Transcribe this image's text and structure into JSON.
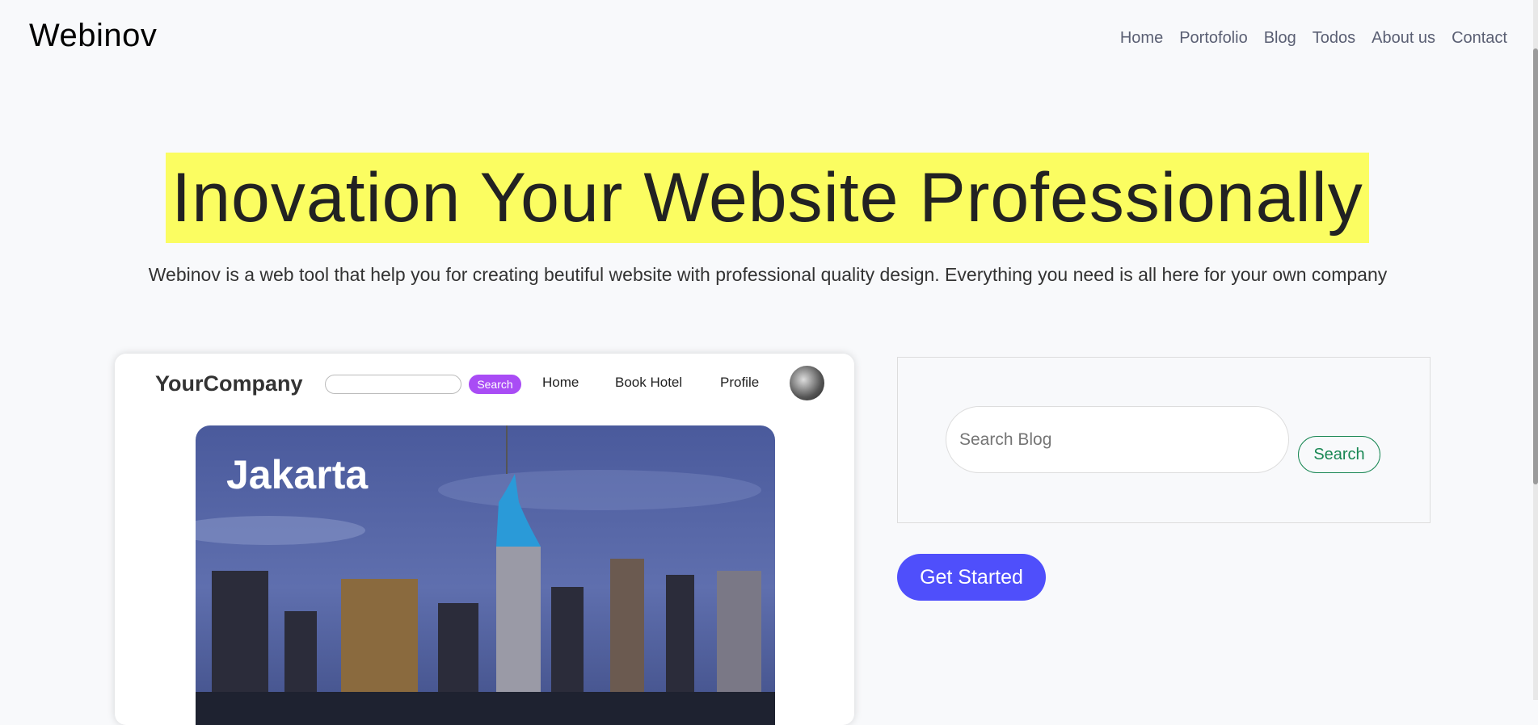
{
  "header": {
    "logo": "Webinov",
    "nav": [
      "Home",
      "Portofolio",
      "Blog",
      "Todos",
      "About us",
      "Contact"
    ]
  },
  "hero": {
    "title": "Inovation Your Website Professionally",
    "lead": "Webinov is a web tool that help you for creating beutiful website with professional quality design. Everything you need is all here for your own company",
    "highlight_color": "#fbfd61"
  },
  "preview": {
    "brand": "YourCompany",
    "search_label": "Search",
    "nav": [
      "Home",
      "Book Hotel",
      "Profile"
    ],
    "city": "Jakarta"
  },
  "blog_search": {
    "placeholder": "Search Blog",
    "button": "Search"
  },
  "cta": {
    "label": "Get Started",
    "color": "#4f4ffb"
  }
}
